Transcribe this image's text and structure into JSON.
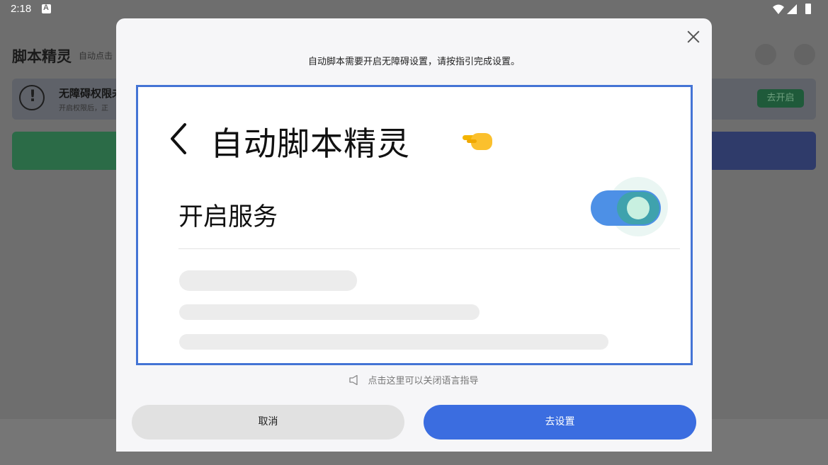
{
  "status_bar": {
    "time": "2:18"
  },
  "app": {
    "title": "脚本精灵",
    "subtitle": "自动点击",
    "banner": {
      "title": "无障碍权限未",
      "subtitle": "开启权限后，正",
      "button": "去开启"
    }
  },
  "dialog": {
    "prompt": "自动脚本需要开启无障碍设置，请按指引完成设置。",
    "illustration": {
      "title": "自动脚本精灵",
      "service_label": "开启服务",
      "toggle_on": true
    },
    "voice_hint": "点击这里可以关闭语言指导",
    "cancel_label": "取消",
    "confirm_label": "去设置"
  },
  "colors": {
    "accent": "#3b6de0",
    "frame_border": "#4474d5",
    "toggle": "#4d90e6"
  }
}
